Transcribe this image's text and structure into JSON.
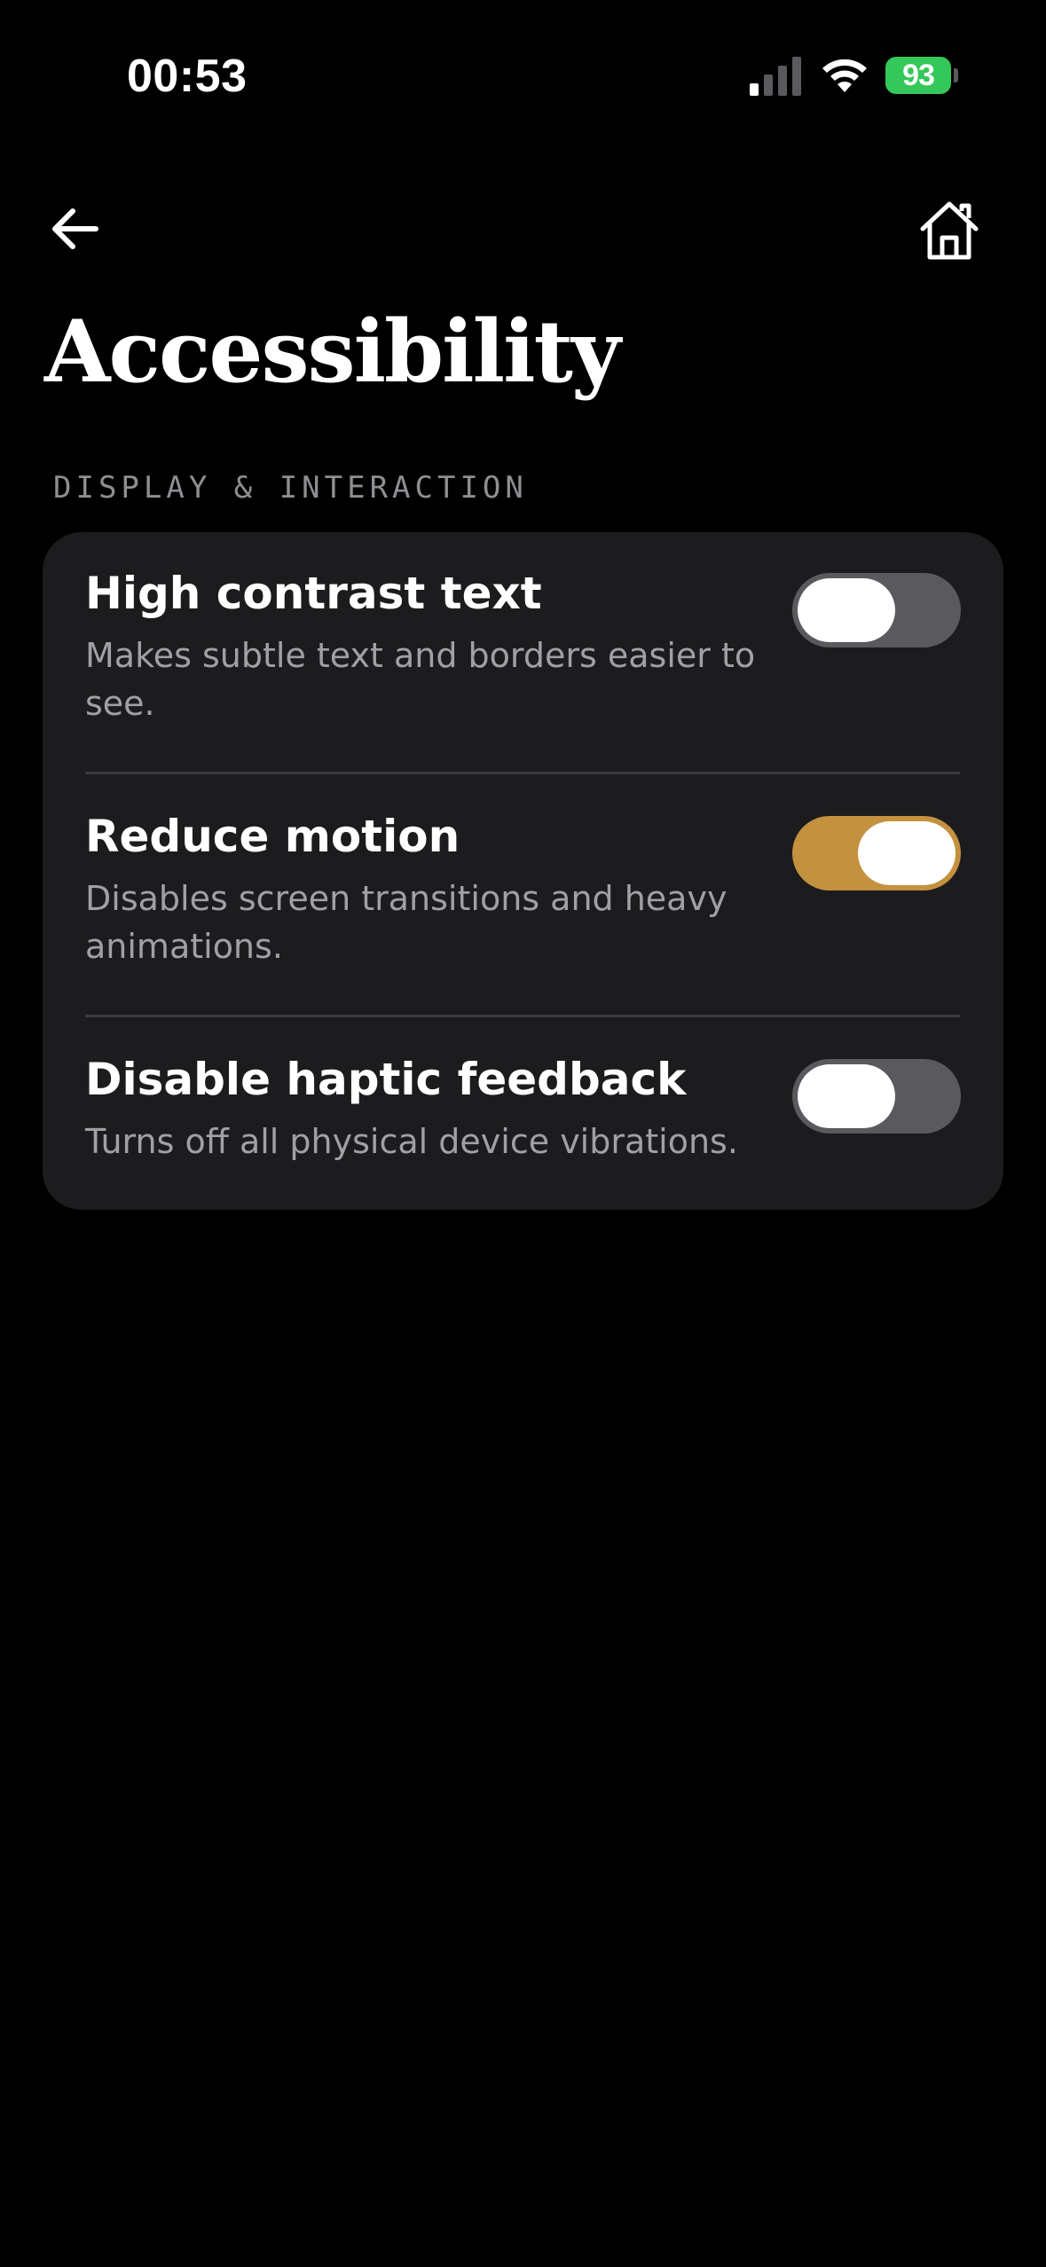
{
  "status_bar": {
    "time": "00:53",
    "battery_level": "93",
    "battery_color": "#34c759",
    "icons": [
      "signal-icon",
      "wifi-icon",
      "battery-icon"
    ]
  },
  "nav": {
    "back_icon": "arrow-left-icon",
    "home_icon": "home-icon"
  },
  "page": {
    "title": "Accessibility"
  },
  "section": {
    "header": "DISPLAY & INTERACTION",
    "settings": [
      {
        "title": "High contrast text",
        "description": "Makes subtle text and borders easier to see.",
        "enabled": false
      },
      {
        "title": "Reduce motion",
        "description": "Disables screen transitions and heavy animations.",
        "enabled": true
      },
      {
        "title": "Disable haptic feedback",
        "description": "Turns off all physical device vibrations.",
        "enabled": false
      }
    ]
  },
  "colors": {
    "background": "#000000",
    "card": "#1c1c1e",
    "toggle_on": "#c4913f",
    "toggle_off": "#5a5a5e",
    "secondary_text": "#a0a0a5"
  }
}
